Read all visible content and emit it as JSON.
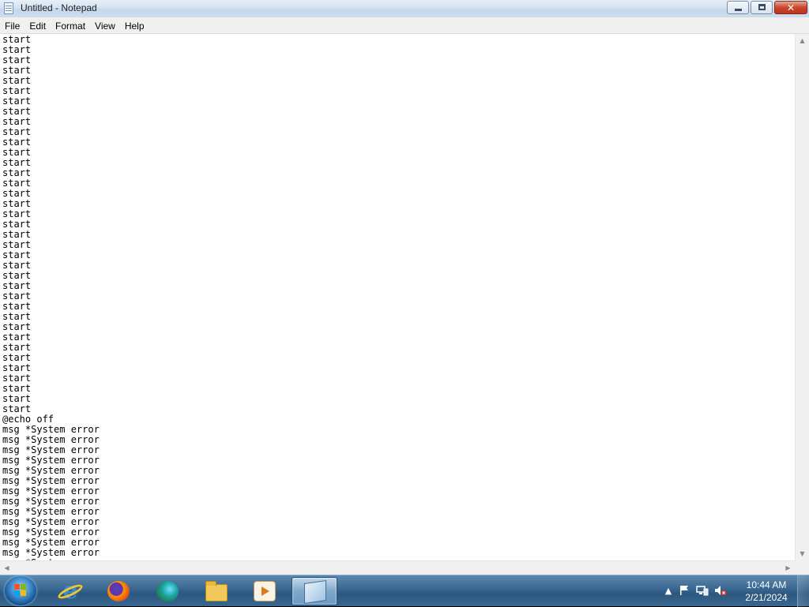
{
  "window": {
    "title": "Untitled - Notepad",
    "close_glyph": "✕"
  },
  "menu": [
    "File",
    "Edit",
    "Format",
    "View",
    "Help"
  ],
  "editor": {
    "text": "start\nstart\nstart\nstart\nstart\nstart\nstart\nstart\nstart\nstart\nstart\nstart\nstart\nstart\nstart\nstart\nstart\nstart\nstart\nstart\nstart\nstart\nstart\nstart\nstart\nstart\nstart\nstart\nstart\nstart\nstart\nstart\nstart\nstart\nstart\nstart\nstart\n@echo off\nmsg *System error\nmsg *System error\nmsg *System error\nmsg *System error\nmsg *System error\nmsg *System error\nmsg *System error\nmsg *System error\nmsg *System error\nmsg *System error\nmsg *System error\nmsg *System error\nmsg *System error\nmsg *System error\nmsg *"
  },
  "scrollbars": {
    "up": "▲",
    "down": "▼",
    "left": "◀",
    "right": "▶"
  },
  "taskbar": {
    "pinned": [
      "internet-explorer-icon",
      "firefox-icon",
      "edge-icon",
      "file-explorer-icon",
      "media-player-icon",
      "notepad-icon"
    ],
    "ie_glyph": "e"
  },
  "tray": {
    "show_hidden": "▲",
    "time": "10:44 AM",
    "date": "2/21/2024"
  },
  "colors": {
    "taskbar": "#3c6a94",
    "titlebar": "#d4e2f1",
    "close_button": "#c9462c"
  }
}
